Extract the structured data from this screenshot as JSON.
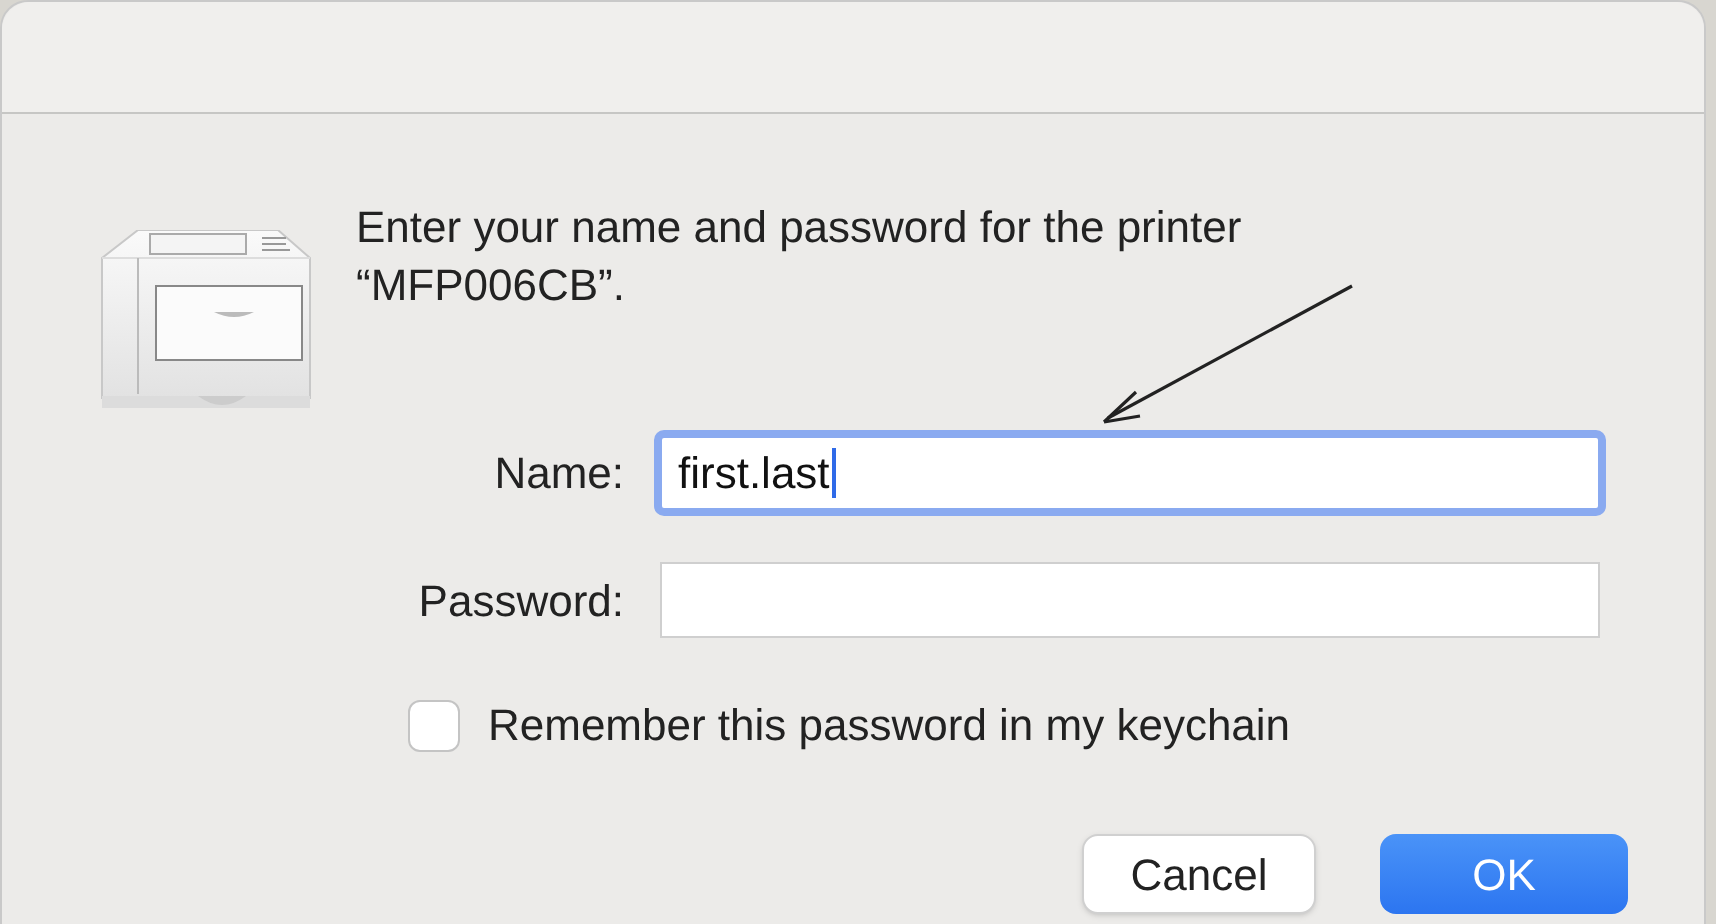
{
  "dialog": {
    "message_line_1": "Enter your name and password for the printer",
    "message_line_2": "“MFP006CB”."
  },
  "fields": [
    {
      "label": "Name:",
      "value": "first.last",
      "focused": true
    },
    {
      "label": "Password:",
      "focused": false
    }
  ],
  "remember": {
    "label": "Remember this password in my keychain",
    "checked": false
  },
  "buttons": [
    {
      "label": "Cancel",
      "kind": "normal"
    },
    {
      "label": "OK",
      "kind": "default"
    }
  ]
}
